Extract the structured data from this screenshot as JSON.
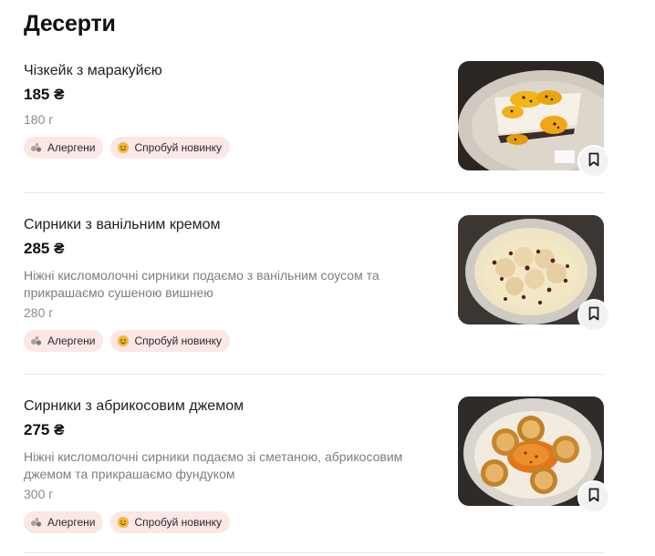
{
  "section": {
    "title": "Десерти"
  },
  "badges": {
    "allergens": "Алергени",
    "try_new": "Спробуй новинку"
  },
  "icons": {
    "allergens": "allergens-icon",
    "try_new": "smiley-icon",
    "bookmark": "bookmark-icon"
  },
  "colors": {
    "badge_bg": "#fbe7e6",
    "price": "#111111",
    "muted": "#7d7d7d"
  },
  "items": [
    {
      "name": "Чізкейк з маракуйєю",
      "price": "185 ₴",
      "description": "",
      "weight": "180 г"
    },
    {
      "name": "Сирники з ванільним кремом",
      "price": "285 ₴",
      "description": "Ніжні кисломолочні сирники подаємо з ванільним соусом та прикрашаємо сушеною вишнею",
      "weight": "280 г"
    },
    {
      "name": "Сирники з абрикосовим джемом",
      "price": "275 ₴",
      "description": "Ніжні кисломолочні сирники подаємо зі сметаною, абрикосовим джемом та прикрашаємо фундуком",
      "weight": "300 г"
    }
  ]
}
